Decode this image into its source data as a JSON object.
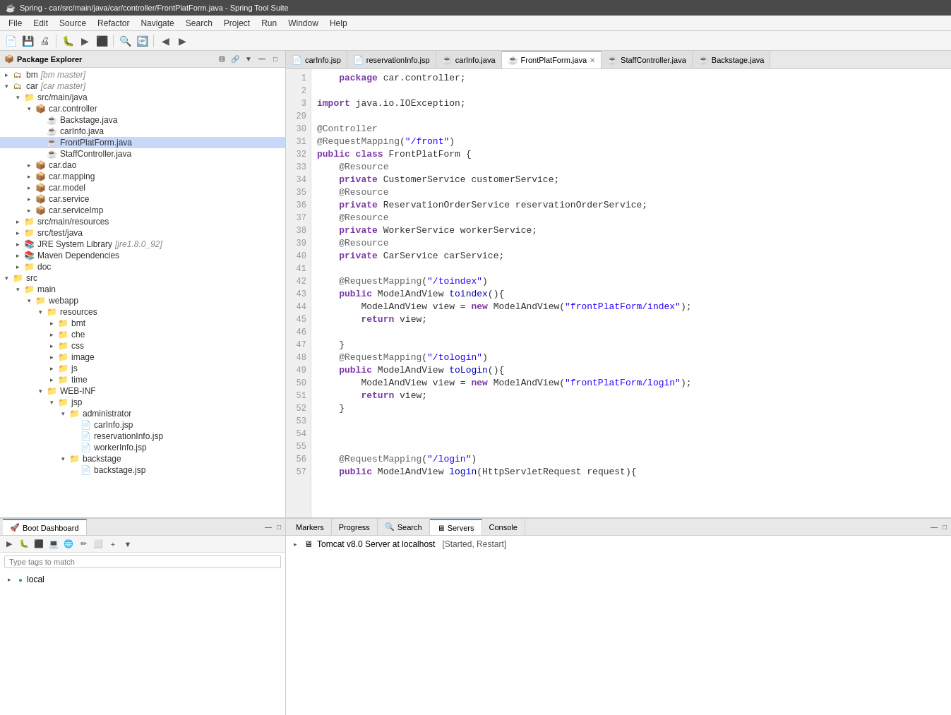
{
  "titleBar": {
    "icon": "☕",
    "title": "Spring - car/src/main/java/car/controller/FrontPlatForm.java - Spring Tool Suite"
  },
  "menuBar": {
    "items": [
      "File",
      "Edit",
      "Source",
      "Refactor",
      "Navigate",
      "Search",
      "Project",
      "Run",
      "Window",
      "Help"
    ]
  },
  "packageExplorer": {
    "title": "Package Explorer",
    "tree": [
      {
        "level": 0,
        "expanded": true,
        "icon": "📁",
        "label": "bm",
        "extra": "[bm master]"
      },
      {
        "level": 0,
        "expanded": true,
        "icon": "📁",
        "label": "car",
        "extra": "[car master]"
      },
      {
        "level": 1,
        "expanded": true,
        "icon": "📁",
        "label": "src/main/java"
      },
      {
        "level": 2,
        "expanded": true,
        "icon": "📦",
        "label": "car.controller"
      },
      {
        "level": 3,
        "expanded": false,
        "icon": "☕",
        "label": "Backstage.java"
      },
      {
        "level": 3,
        "expanded": false,
        "icon": "☕",
        "label": "carInfo.java"
      },
      {
        "level": 3,
        "expanded": false,
        "icon": "☕",
        "label": "FrontPlatForm.java",
        "selected": true
      },
      {
        "level": 3,
        "expanded": false,
        "icon": "☕",
        "label": "StaffController.java"
      },
      {
        "level": 2,
        "expanded": false,
        "icon": "📦",
        "label": "car.dao"
      },
      {
        "level": 2,
        "expanded": false,
        "icon": "📦",
        "label": "car.mapping"
      },
      {
        "level": 2,
        "expanded": false,
        "icon": "📦",
        "label": "car.model"
      },
      {
        "level": 2,
        "expanded": false,
        "icon": "📦",
        "label": "car.service"
      },
      {
        "level": 2,
        "expanded": false,
        "icon": "📦",
        "label": "car.serviceImp"
      },
      {
        "level": 1,
        "expanded": false,
        "icon": "📁",
        "label": "src/main/resources"
      },
      {
        "level": 1,
        "expanded": false,
        "icon": "📁",
        "label": "src/test/java"
      },
      {
        "level": 1,
        "expanded": false,
        "icon": "📚",
        "label": "JRE System Library",
        "extra": "[jre1.8.0_92]"
      },
      {
        "level": 1,
        "expanded": false,
        "icon": "📚",
        "label": "Maven Dependencies"
      },
      {
        "level": 1,
        "expanded": false,
        "icon": "📁",
        "label": "doc"
      },
      {
        "level": 0,
        "expanded": true,
        "icon": "📁",
        "label": "src"
      },
      {
        "level": 1,
        "expanded": true,
        "icon": "📁",
        "label": "main"
      },
      {
        "level": 2,
        "expanded": true,
        "icon": "📁",
        "label": "webapp"
      },
      {
        "level": 3,
        "expanded": true,
        "icon": "📁",
        "label": "resources"
      },
      {
        "level": 4,
        "expanded": false,
        "icon": "📁",
        "label": "bmt"
      },
      {
        "level": 4,
        "expanded": false,
        "icon": "📁",
        "label": "che"
      },
      {
        "level": 4,
        "expanded": false,
        "icon": "📁",
        "label": "css"
      },
      {
        "level": 4,
        "expanded": false,
        "icon": "📁",
        "label": "image"
      },
      {
        "level": 4,
        "expanded": false,
        "icon": "📁",
        "label": "js"
      },
      {
        "level": 4,
        "expanded": false,
        "icon": "📁",
        "label": "time"
      },
      {
        "level": 3,
        "expanded": true,
        "icon": "📁",
        "label": "WEB-INF"
      },
      {
        "level": 4,
        "expanded": true,
        "icon": "📁",
        "label": "jsp"
      },
      {
        "level": 5,
        "expanded": true,
        "icon": "📁",
        "label": "administrator"
      },
      {
        "level": 6,
        "expanded": false,
        "icon": "📄",
        "label": "carInfo.jsp"
      },
      {
        "level": 6,
        "expanded": false,
        "icon": "📄",
        "label": "reservationInfo.jsp"
      },
      {
        "level": 6,
        "expanded": false,
        "icon": "📄",
        "label": "workerInfo.jsp"
      },
      {
        "level": 5,
        "expanded": true,
        "icon": "📁",
        "label": "backstage"
      },
      {
        "level": 6,
        "expanded": false,
        "icon": "📄",
        "label": "backstage.jsp"
      }
    ]
  },
  "editorTabs": [
    {
      "id": "carInfo_jsp",
      "icon": "📄",
      "label": "carInfo.jsp",
      "active": false,
      "modified": false
    },
    {
      "id": "reservationInfo_jsp",
      "icon": "📄",
      "label": "reservationInfo.jsp",
      "active": false,
      "modified": false
    },
    {
      "id": "carInfo_java",
      "icon": "☕",
      "label": "carInfo.java",
      "active": false,
      "modified": false
    },
    {
      "id": "FrontPlatForm_java",
      "icon": "☕",
      "label": "FrontPlatForm.java",
      "active": true,
      "modified": false
    },
    {
      "id": "StaffController_java",
      "icon": "☕",
      "label": "StaffController.java",
      "active": false,
      "modified": false
    },
    {
      "id": "Backstage_java",
      "icon": "☕",
      "label": "Backstage.java",
      "active": false,
      "modified": false
    }
  ],
  "codeLines": [
    {
      "num": "1",
      "code": "    package car.controller;"
    },
    {
      "num": "2",
      "code": ""
    },
    {
      "num": "3",
      "code": "import java.io.IOException;"
    },
    {
      "num": "29",
      "code": ""
    },
    {
      "num": "30",
      "code": "@Controller"
    },
    {
      "num": "31",
      "code": "@RequestMapping(\"/front\")"
    },
    {
      "num": "32",
      "code": "public class FrontPlatForm {"
    },
    {
      "num": "33",
      "code": "    @Resource"
    },
    {
      "num": "34",
      "code": "    private CustomerService customerService;"
    },
    {
      "num": "35",
      "code": "    @Resource"
    },
    {
      "num": "36",
      "code": "    private ReservationOrderService reservationOrderService;"
    },
    {
      "num": "37",
      "code": "    @Resource"
    },
    {
      "num": "38",
      "code": "    private WorkerService workerService;"
    },
    {
      "num": "39",
      "code": "    @Resource"
    },
    {
      "num": "40",
      "code": "    private CarService carService;"
    },
    {
      "num": "41",
      "code": ""
    },
    {
      "num": "42",
      "code": "    @RequestMapping(\"/toindex\")"
    },
    {
      "num": "43",
      "code": "    public ModelAndView toindex(){"
    },
    {
      "num": "44",
      "code": "        ModelAndView view = new ModelAndView(\"frontPlatForm/index\");"
    },
    {
      "num": "45",
      "code": "        return view;"
    },
    {
      "num": "46",
      "code": ""
    },
    {
      "num": "47",
      "code": "    }"
    },
    {
      "num": "48",
      "code": "    @RequestMapping(\"/tologin\")"
    },
    {
      "num": "49",
      "code": "    public ModelAndView toLogin(){"
    },
    {
      "num": "50",
      "code": "        ModelAndView view = new ModelAndView(\"frontPlatForm/login\");"
    },
    {
      "num": "51",
      "code": "        return view;"
    },
    {
      "num": "52",
      "code": "    }"
    },
    {
      "num": "53",
      "code": ""
    },
    {
      "num": "54",
      "code": ""
    },
    {
      "num": "55",
      "code": ""
    },
    {
      "num": "56",
      "code": "    @RequestMapping(\"/login\")"
    },
    {
      "num": "57",
      "code": "    public ModelAndView login(HttpServletRequest request){"
    }
  ],
  "bottomLeft": {
    "title": "Boot Dashboard",
    "searchPlaceholder": "Type tags to match",
    "localLabel": "local",
    "localStatus": "running"
  },
  "bottomRight": {
    "tabs": [
      {
        "id": "markers",
        "label": "Markers",
        "active": false
      },
      {
        "id": "progress",
        "label": "Progress",
        "active": false
      },
      {
        "id": "search",
        "label": "Search",
        "active": false
      },
      {
        "id": "servers",
        "label": "Servers",
        "active": true
      },
      {
        "id": "console",
        "label": "Console",
        "active": false
      }
    ],
    "serverEntry": {
      "label": "Tomcat v8.0 Server at localhost",
      "status": "[Started, Restart]"
    }
  }
}
